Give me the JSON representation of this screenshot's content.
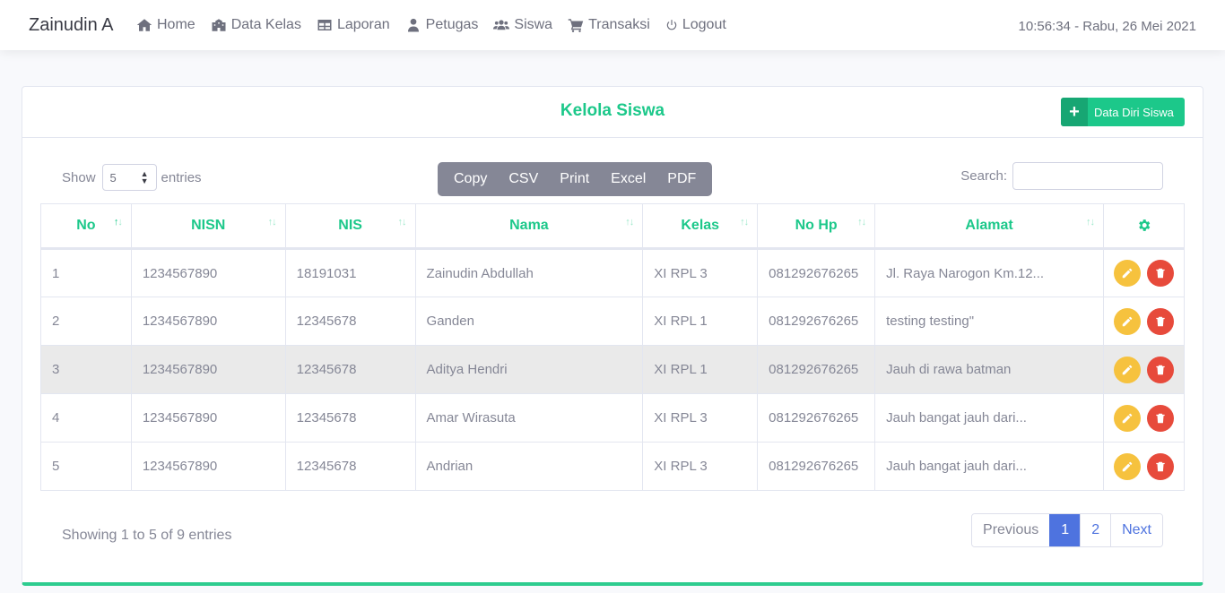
{
  "nav": {
    "brand": "Zainudin A",
    "items": [
      {
        "label": "Home",
        "icon": "home-icon"
      },
      {
        "label": "Data Kelas",
        "icon": "school-icon"
      },
      {
        "label": "Laporan",
        "icon": "table-icon"
      },
      {
        "label": "Petugas",
        "icon": "user-tie-icon"
      },
      {
        "label": "Siswa",
        "icon": "users-icon"
      },
      {
        "label": "Transaksi",
        "icon": "cart-icon"
      },
      {
        "label": "Logout",
        "icon": "power-icon"
      }
    ],
    "clock": "10:56:34 - Rabu, 26 Mei 2021"
  },
  "card": {
    "title": "Kelola Siswa",
    "add_button": "Data Diri Siswa",
    "add_icon": "+"
  },
  "length": {
    "show": "Show",
    "value": "5",
    "entries": "entries"
  },
  "buttons": [
    "Copy",
    "CSV",
    "Print",
    "Excel",
    "PDF"
  ],
  "search": {
    "label": "Search:",
    "value": ""
  },
  "table": {
    "headers": [
      "No",
      "NISN",
      "NIS",
      "Nama",
      "Kelas",
      "No Hp",
      "Alamat"
    ],
    "rows": [
      [
        "1",
        "1234567890",
        "18191031",
        "Zainudin Abdullah",
        "XI RPL 3",
        "081292676265",
        "Jl. Raya Narogon Km.12..."
      ],
      [
        "2",
        "1234567890",
        "12345678",
        "Ganden",
        "XI RPL 1",
        "081292676265",
        "testing testing\""
      ],
      [
        "3",
        "1234567890",
        "12345678",
        "Aditya Hendri",
        "XI RPL 1",
        "081292676265",
        "Jauh di rawa batman"
      ],
      [
        "4",
        "1234567890",
        "12345678",
        "Amar Wirasuta",
        "XI RPL 3",
        "081292676265",
        "Jauh bangat jauh dari..."
      ],
      [
        "5",
        "1234567890",
        "12345678",
        "Andrian",
        "XI RPL 3",
        "081292676265",
        "Jauh bangat jauh dari..."
      ]
    ]
  },
  "footer": {
    "info": "Showing 1 to 5 of 9 entries",
    "pages": [
      "Previous",
      "1",
      "2",
      "Next"
    ]
  },
  "colors": {
    "accent": "#1cc88a",
    "primary": "#4e73df",
    "warning": "#f6c23e",
    "danger": "#e74a3b"
  }
}
